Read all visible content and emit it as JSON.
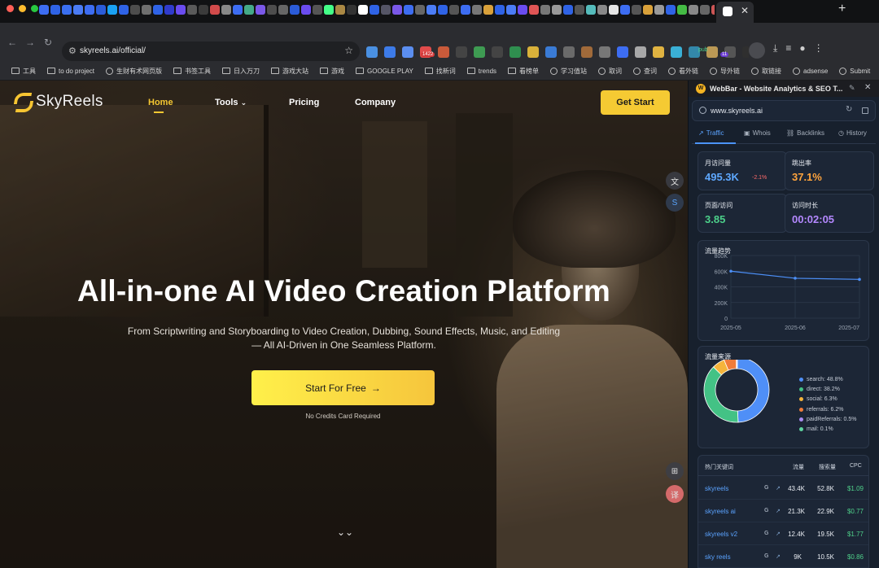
{
  "browser": {
    "url": "skyreels.ai/official/",
    "bookmarks": [
      "工具",
      "to do project",
      "生财有术网页版",
      "书签工具",
      "日入万刀",
      "游戏大站",
      "游戏",
      "GOOGLE PLAY",
      "找新词",
      "trends",
      "看榜单",
      "学习值站",
      "取词",
      "查词",
      "看外链",
      "导外链",
      "取链接",
      "adsense",
      "Submit"
    ],
    "extension_badge": "1422",
    "extension_badge2": "11",
    "extension_label": "pub"
  },
  "site": {
    "brand": "SkyReels",
    "nav": [
      "Home",
      "Tools",
      "Pricing",
      "Company"
    ],
    "get_start": "Get Start",
    "hero_title": "All-in-one AI Video Creation Platform",
    "hero_sub_1": "From Scriptwriting and Storyboarding to Video Creation, Dubbing, Sound Effects, Music, and Editing",
    "hero_sub_2": "— All AI-Driven in One Seamless Platform.",
    "cta": "Start For Free",
    "cta_note": "No Credits Card Required"
  },
  "webbar": {
    "title": "WebBar - Website Analytics & SEO T...",
    "domain": "www.skyreels.ai",
    "tabs": [
      "Traffic",
      "Whois",
      "Backlinks",
      "History"
    ],
    "metrics": [
      {
        "label": "月访问量",
        "value": "495.3K",
        "change": "-2.1%",
        "color": "#5ea8ff"
      },
      {
        "label": "跳出率",
        "value": "37.1%",
        "color": "#ffa43d"
      },
      {
        "label": "页面/访问",
        "value": "3.85",
        "color": "#4cd08a"
      },
      {
        "label": "访问时长",
        "value": "00:02:05",
        "color": "#b488ff"
      }
    ],
    "trend_title": "流量趋势",
    "source_title": "流量来源",
    "keywords_title": "热门关键词",
    "keyword_headers": [
      "流量",
      "搜索量",
      "CPC"
    ],
    "keywords": [
      {
        "kw": "skyreels",
        "traffic": "43.4K",
        "volume": "52.8K",
        "cpc": "$1.09"
      },
      {
        "kw": "skyreels ai",
        "traffic": "21.3K",
        "volume": "22.9K",
        "cpc": "$0.77"
      },
      {
        "kw": "skyreels v2",
        "traffic": "12.4K",
        "volume": "19.5K",
        "cpc": "$1.77"
      },
      {
        "kw": "sky reels",
        "traffic": "9K",
        "volume": "10.5K",
        "cpc": "$0.86"
      }
    ]
  },
  "chart_data": [
    {
      "type": "line",
      "title": "流量趋势",
      "x": [
        "2025-05",
        "2025-06",
        "2025-07"
      ],
      "series": [
        {
          "values": [
            600000,
            510000,
            495300
          ]
        }
      ],
      "ylim": [
        0,
        800000
      ],
      "yticks": [
        "0",
        "200K",
        "400K",
        "600K",
        "800K"
      ],
      "grid": true
    },
    {
      "type": "pie",
      "title": "流量来源",
      "labels": [
        "search",
        "direct",
        "social",
        "referrals",
        "paidReferrals",
        "mail"
      ],
      "values": [
        48.8,
        38.2,
        6.3,
        6.2,
        0.5,
        0.1
      ],
      "value_labels": [
        "search: 48.8%",
        "direct: 38.2%",
        "social: 6.3%",
        "referrals: 6.2%",
        "paidReferrals: 0.5%",
        "mail: 0.1%"
      ],
      "colors": [
        "#4f8ff7",
        "#43c285",
        "#f5b43b",
        "#f07c3a",
        "#a98bf2",
        "#5fd4a0"
      ],
      "legend": "right"
    }
  ]
}
